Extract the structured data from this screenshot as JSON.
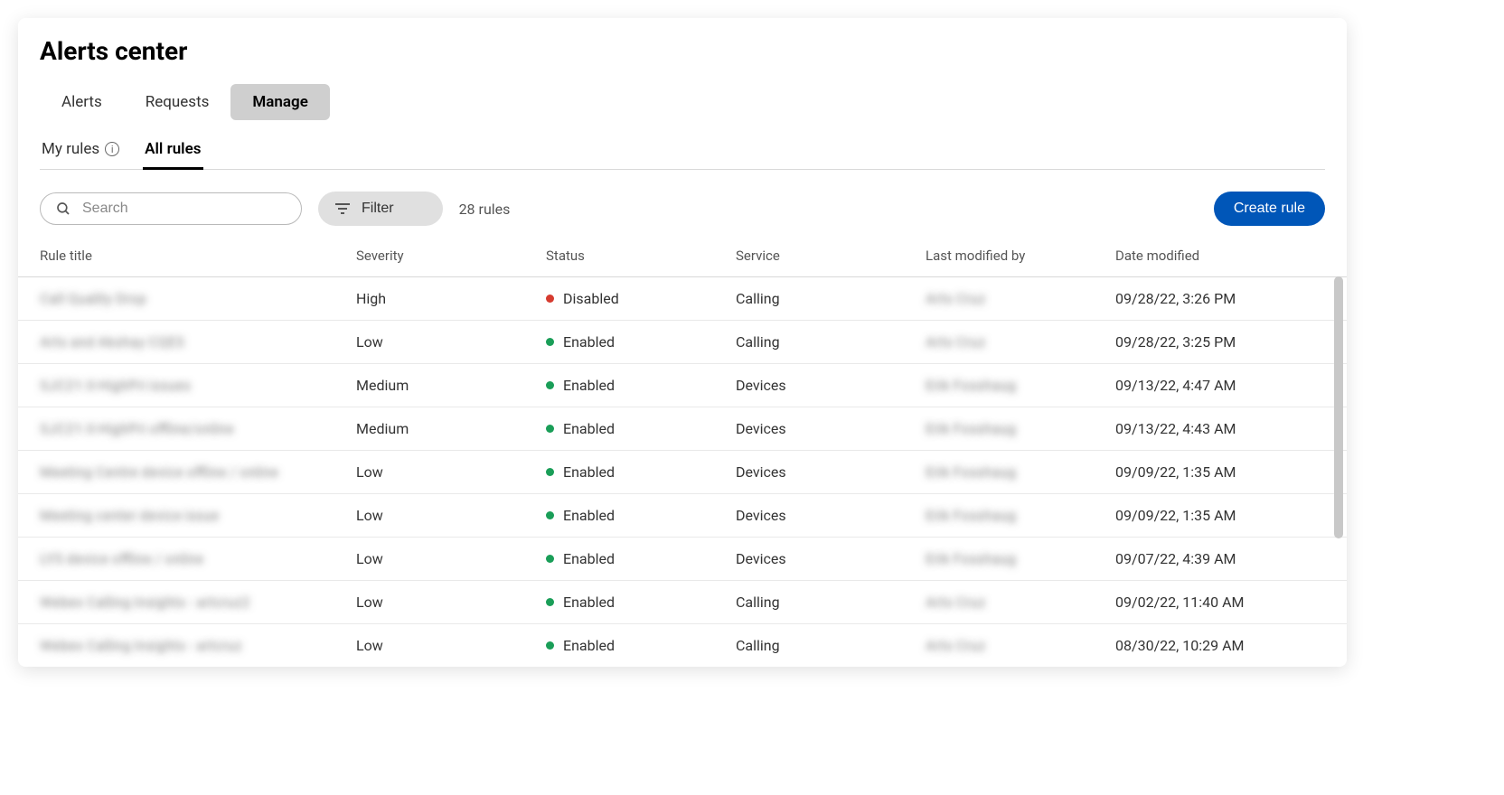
{
  "page": {
    "title": "Alerts center"
  },
  "primary_tabs": [
    {
      "label": "Alerts",
      "active": false
    },
    {
      "label": "Requests",
      "active": false
    },
    {
      "label": "Manage",
      "active": true
    }
  ],
  "sub_tabs": [
    {
      "label": "My rules",
      "active": false,
      "has_info": true
    },
    {
      "label": "All rules",
      "active": true,
      "has_info": false
    }
  ],
  "toolbar": {
    "search_placeholder": "Search",
    "filter_label": "Filter",
    "rule_count": "28 rules",
    "create_label": "Create rule"
  },
  "columns": {
    "title": "Rule title",
    "severity": "Severity",
    "status": "Status",
    "service": "Service",
    "modified_by": "Last modified by",
    "date": "Date modified"
  },
  "rows": [
    {
      "title": "Call Quality Drop",
      "severity": "High",
      "status": "Disabled",
      "status_color": "red",
      "service": "Calling",
      "modified_by": "Arts Cruz",
      "date": "09/28/22, 3:26 PM"
    },
    {
      "title": "Arts and Akshay CQES",
      "severity": "Low",
      "status": "Enabled",
      "status_color": "green",
      "service": "Calling",
      "modified_by": "Arts Cruz",
      "date": "09/28/22, 3:25 PM"
    },
    {
      "title": "SJC21-3-HighPri issues",
      "severity": "Medium",
      "status": "Enabled",
      "status_color": "green",
      "service": "Devices",
      "modified_by": "Erik Fosshaug",
      "date": "09/13/22, 4:47 AM"
    },
    {
      "title": "SJC21-3-HighPri offline/online",
      "severity": "Medium",
      "status": "Enabled",
      "status_color": "green",
      "service": "Devices",
      "modified_by": "Erik Fosshaug",
      "date": "09/13/22, 4:43 AM"
    },
    {
      "title": "Meeting Centre device offline / online",
      "severity": "Low",
      "status": "Enabled",
      "status_color": "green",
      "service": "Devices",
      "modified_by": "Erik Fosshaug",
      "date": "09/09/22, 1:35 AM"
    },
    {
      "title": "Meeting center device issue",
      "severity": "Low",
      "status": "Enabled",
      "status_color": "green",
      "service": "Devices",
      "modified_by": "Erik Fosshaug",
      "date": "09/09/22, 1:35 AM"
    },
    {
      "title": "LYS device offline / online",
      "severity": "Low",
      "status": "Enabled",
      "status_color": "green",
      "service": "Devices",
      "modified_by": "Erik Fosshaug",
      "date": "09/07/22, 4:39 AM"
    },
    {
      "title": "Webex Calling Insights - artcruz2",
      "severity": "Low",
      "status": "Enabled",
      "status_color": "green",
      "service": "Calling",
      "modified_by": "Arts Cruz",
      "date": "09/02/22, 11:40 AM"
    },
    {
      "title": "Webex Calling Insights - artcruz",
      "severity": "Low",
      "status": "Enabled",
      "status_color": "green",
      "service": "Calling",
      "modified_by": "Arts Cruz",
      "date": "08/30/22, 10:29 AM"
    }
  ]
}
